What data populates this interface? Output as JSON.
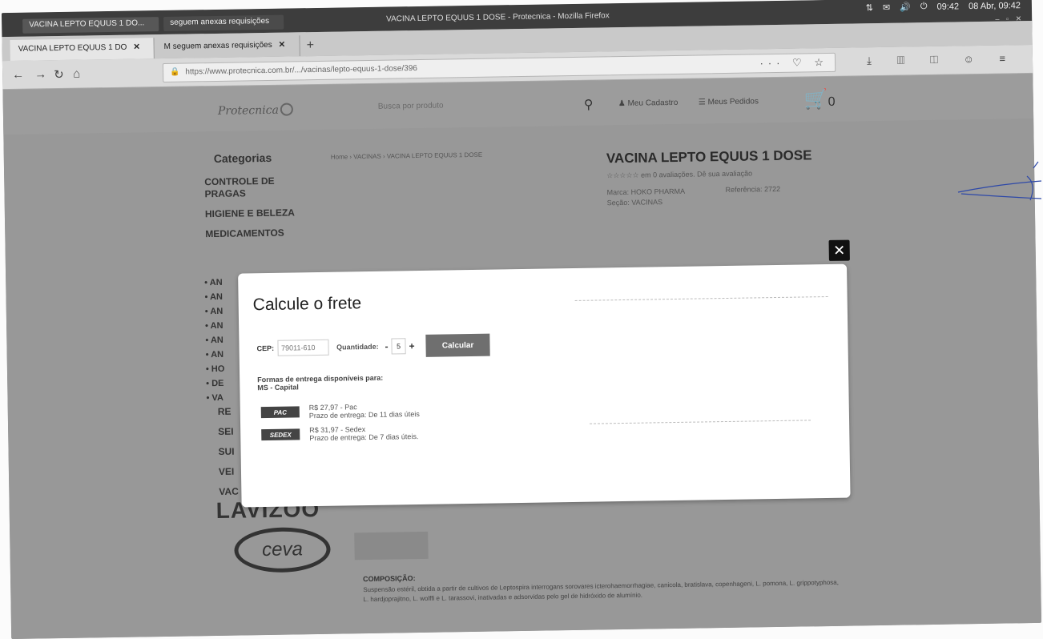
{
  "os": {
    "tab1": "VACINA LEPTO EQUUS 1 DO...",
    "tab2": "seguem anexas requisições",
    "window_title": "VACINA LEPTO EQUUS 1 DOSE - Protecnica - Mozilla Firefox",
    "tray_time": "09:42",
    "tray_date": "08 Abr, 09:42"
  },
  "browser": {
    "tabs": [
      {
        "label": "VACINA LEPTO EQUUS 1 DO",
        "close": "✕"
      },
      {
        "label": "seguem anexas requisições",
        "close": "✕"
      }
    ],
    "new_tab": "+",
    "url": "https://www.protecnica.com.br/.../vacinas/lepto-equus-1-dose/396",
    "url_actions": "··· ♡ ☆"
  },
  "site": {
    "logo": "Protecnica",
    "search_placeholder": "Busca por produto",
    "account": "Meu Cadastro",
    "orders": "Meus Pedidos",
    "cart_count": "0",
    "categories_title": "Categorias",
    "categories": [
      "CONTROLE DE PRAGAS",
      "HIGIENE E BELEZA",
      "MEDICAMENTOS"
    ],
    "side_items": [
      "• AN",
      "• AN",
      "• AN",
      "• AN",
      "• AN",
      "• AN",
      "• HO",
      "• DE",
      "• VA"
    ],
    "side_items2": [
      "RE",
      "SEI",
      "SUI",
      "VEI",
      "VAC"
    ],
    "breadcrumb": "Home  ›  VACINAS  ›  VACINA LEPTO EQUUS 1 DOSE",
    "product_title": "VACINA LEPTO EQUUS 1 DOSE",
    "rating": "☆☆☆☆☆  em 0 avaliações. Dê sua avaliação",
    "brand": "Marca: HOKO PHARMA",
    "section": "Seção: VACINAS",
    "reference": "Referência: 2722",
    "brand_lavizoo": "LAVIZOO",
    "brand_ceva": "ceva",
    "composition_title": "COMPOSIÇÃO:",
    "composition_text": "Suspensão estéril, obtida a partir de cultivos de Leptospira interrogans sorovares icterohaemorrhagiae, canicola, bratislava, copenhageni, L. pomona, L. grippotyphosa, L. hardjoprajitno, L. wolffi e L. tarassovi, inativadas e adsorvidas pelo gel de hidróxido de alumínio."
  },
  "modal": {
    "title": "Calcule o frete",
    "close": "✕",
    "cep_label": "CEP:",
    "cep_value": "79011-610",
    "qty_label": "Quantidade:",
    "qty_minus": "-",
    "qty_value": "5",
    "qty_plus": "+",
    "calc_button": "Calcular",
    "formas_line1": "Formas de entrega disponíveis para:",
    "formas_line2": "MS - Capital",
    "shipping": [
      {
        "logo": "PAC",
        "price": "R$ 27,97 - Pac",
        "deadline": "Prazo de entrega: De 11 dias úteis"
      },
      {
        "logo": "SEDEX",
        "price": "R$ 31,97 - Sedex",
        "deadline": "Prazo de entrega: De 7 dias úteis."
      }
    ]
  }
}
